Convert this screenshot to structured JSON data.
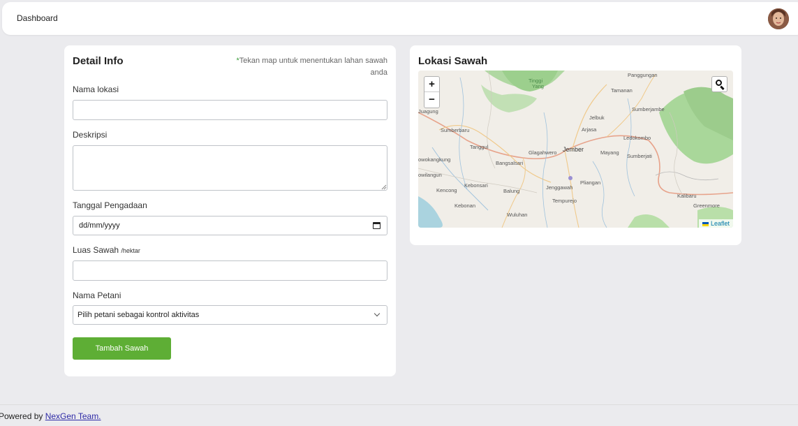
{
  "header": {
    "title": "Dashboard"
  },
  "form": {
    "title": "Detail Info",
    "hint_star": "*",
    "hint": "Tekan map untuk menentukan lahan sawah anda",
    "nama_lokasi_label": "Nama lokasi",
    "nama_lokasi_value": "",
    "deskripsi_label": "Deskripsi",
    "deskripsi_value": "",
    "tanggal_label": "Tanggal Pengadaan",
    "tanggal_placeholder": "dd/mm/yyyy",
    "luas_label": "Luas Sawah",
    "luas_unit": "/hektar",
    "luas_value": "",
    "petani_label": "Nama Petani",
    "petani_selected": "Pilih petani sebagai kontrol aktivitas",
    "submit_label": "Tambah Sawah"
  },
  "map": {
    "title": "Lokasi Sawah",
    "zoom_in": "+",
    "zoom_out": "−",
    "attribution": "Leaflet",
    "places": {
      "panggungan": "Panggungan",
      "tamanan": "Tamanan",
      "sumberjambe": "Sumberjambe",
      "jelbuk": "Jelbuk",
      "arjasa": "Arjasa",
      "ledokombo": "Ledokombo",
      "sumberbaru": "Sumberbaru",
      "tanggul": "Tanggul",
      "jember": "Jember",
      "mayang": "Mayang",
      "sumberjati": "Sumberjati",
      "gladakwero": "Glagahwero",
      "bangsalsari": "Bangsalsari",
      "rowokangkung": "owokangkung",
      "wilangun": "owilangun",
      "kebonsari": "Kebonsari",
      "pliangan": "Pliangan",
      "jenggawah": "Jenggawah",
      "kencong": "Kencong",
      "balung": "Balung",
      "tempurejo": "Tempurejo",
      "kalibaru": "Kalibaru",
      "kebonan": "Kebonan",
      "wuluhan": "Wuluhan",
      "greenmore": "Greenmore",
      "juagung": "Juagung",
      "ranu": "Tinggi",
      "yang": "Yang"
    }
  },
  "footer": {
    "text": "Powered by ",
    "link": "NexGen Team."
  },
  "colors": {
    "accent": "#5eae35",
    "link": "#2e2aa6",
    "background": "#ebebee"
  }
}
